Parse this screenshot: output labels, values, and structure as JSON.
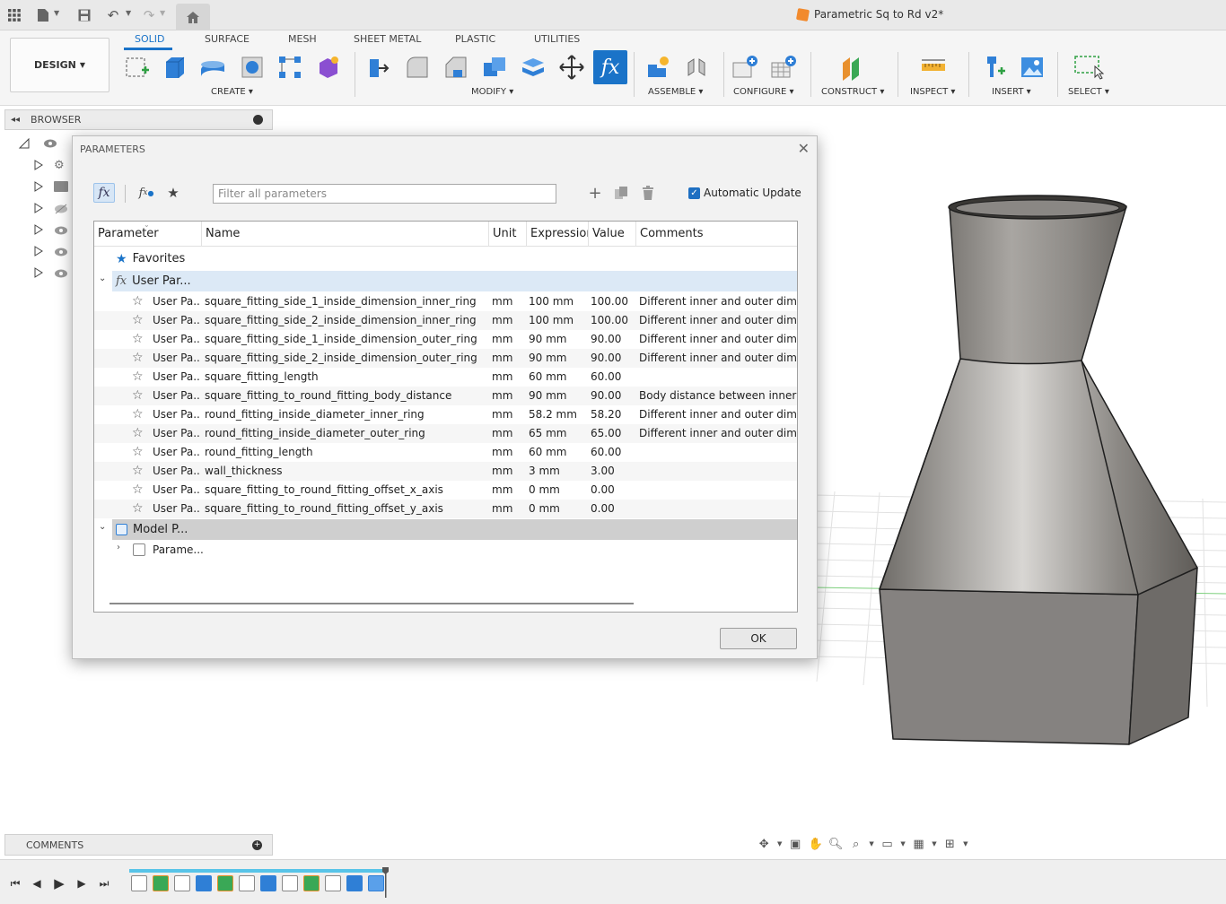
{
  "app": {
    "title": "Parametric Sq to Rd v2*"
  },
  "ribbon": {
    "workspace": "DESIGN",
    "tabs": [
      "SOLID",
      "SURFACE",
      "MESH",
      "SHEET METAL",
      "PLASTIC",
      "UTILITIES"
    ],
    "groups": {
      "create": "CREATE",
      "modify": "MODIFY",
      "assemble": "ASSEMBLE",
      "configure": "CONFIGURE",
      "construct": "CONSTRUCT",
      "inspect": "INSPECT",
      "insert": "INSERT",
      "select": "SELECT"
    }
  },
  "browser": {
    "title": "BROWSER"
  },
  "comments": {
    "title": "COMMENTS"
  },
  "dialog": {
    "title": "PARAMETERS",
    "filter_placeholder": "Filter all parameters",
    "auto_update_label": "Automatic Update",
    "ok_label": "OK",
    "columns": [
      "Parameter",
      "Name",
      "Unit",
      "Expression",
      "Value",
      "Comments"
    ],
    "groups": {
      "favorites": "Favorites",
      "user": "User Par...",
      "model": "Model P...",
      "model_child": "Parame..."
    },
    "rows": [
      {
        "param": "User Pa...",
        "name": "square_fitting_side_1_inside_dimension_inner_ring",
        "unit": "mm",
        "expr": "100 mm",
        "value": "100.00",
        "comment": "Different inner and outer dimensions"
      },
      {
        "param": "User Pa...",
        "name": "square_fitting_side_2_inside_dimension_inner_ring",
        "unit": "mm",
        "expr": "100 mm",
        "value": "100.00",
        "comment": "Different inner and outer dimensions"
      },
      {
        "param": "User Pa...",
        "name": "square_fitting_side_1_inside_dimension_outer_ring",
        "unit": "mm",
        "expr": "90 mm",
        "value": "90.00",
        "comment": "Different inner and outer dimensions"
      },
      {
        "param": "User Pa...",
        "name": "square_fitting_side_2_inside_dimension_outer_ring",
        "unit": "mm",
        "expr": "90 mm",
        "value": "90.00",
        "comment": "Different inner and outer dimensions"
      },
      {
        "param": "User Pa...",
        "name": "square_fitting_length",
        "unit": "mm",
        "expr": "60 mm",
        "value": "60.00",
        "comment": ""
      },
      {
        "param": "User Pa...",
        "name": "square_fitting_to_round_fitting_body_distance",
        "unit": "mm",
        "expr": "90 mm",
        "value": "90.00",
        "comment": "Body distance between inner sq"
      },
      {
        "param": "User Pa...",
        "name": "round_fitting_inside_diameter_inner_ring",
        "unit": "mm",
        "expr": "58.2 mm",
        "value": "58.20",
        "comment": "Different inner and outer dimensions"
      },
      {
        "param": "User Pa...",
        "name": "round_fitting_inside_diameter_outer_ring",
        "unit": "mm",
        "expr": "65 mm",
        "value": "65.00",
        "comment": "Different inner and outer dimensions"
      },
      {
        "param": "User Pa...",
        "name": "round_fitting_length",
        "unit": "mm",
        "expr": "60 mm",
        "value": "60.00",
        "comment": ""
      },
      {
        "param": "User Pa...",
        "name": "wall_thickness",
        "unit": "mm",
        "expr": "3 mm",
        "value": "3.00",
        "comment": ""
      },
      {
        "param": "User Pa...",
        "name": "square_fitting_to_round_fitting_offset_x_axis",
        "unit": "mm",
        "expr": "0 mm",
        "value": "0.00",
        "comment": ""
      },
      {
        "param": "User Pa...",
        "name": "square_fitting_to_round_fitting_offset_y_axis",
        "unit": "mm",
        "expr": "0 mm",
        "value": "0.00",
        "comment": ""
      }
    ]
  },
  "colors": {
    "accent": "#1a73c8",
    "timeline_track": "#58c4e8",
    "model_body": "#8f8b86"
  }
}
